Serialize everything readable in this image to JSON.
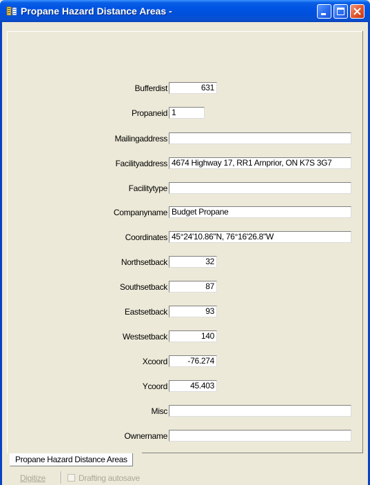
{
  "window": {
    "title": "Propane Hazard Distance Areas -",
    "colors": {
      "titlebar": "#0054e3",
      "close": "#e2552d",
      "face": "#ece9d8"
    }
  },
  "fields": [
    {
      "label": "Bufferdist",
      "value": "631"
    },
    {
      "label": "Propaneid",
      "value": "1"
    },
    {
      "label": "Mailingaddress",
      "value": ""
    },
    {
      "label": "Facilityaddress",
      "value": "4674 Highway 17, RR1 Arnprior, ON K7S 3G7"
    },
    {
      "label": "Facilitytype",
      "value": ""
    },
    {
      "label": "Companyname",
      "value": "Budget Propane"
    },
    {
      "label": "Coordinates",
      "value": "45°24'10.86\"N, 76°16'26.8\"W"
    },
    {
      "label": "Northsetback",
      "value": "32"
    },
    {
      "label": "Southsetback",
      "value": "87"
    },
    {
      "label": "Eastsetback",
      "value": "93"
    },
    {
      "label": "Westsetback",
      "value": "140"
    },
    {
      "label": "Xcoord",
      "value": "-76.274"
    },
    {
      "label": "Ycoord",
      "value": "45.403"
    },
    {
      "label": "Misc",
      "value": ""
    },
    {
      "label": "Ownername",
      "value": ""
    }
  ],
  "tabs": [
    {
      "label": "Propane Hazard Distance Areas"
    }
  ],
  "footer": {
    "digitize_label": "Digitize",
    "drafting_autosave_label": "Drafting autosave",
    "drafting_autosave_checked": false
  },
  "icons": [
    "app-icon",
    "minimize-icon",
    "maximize-icon",
    "close-icon",
    "checkbox"
  ]
}
